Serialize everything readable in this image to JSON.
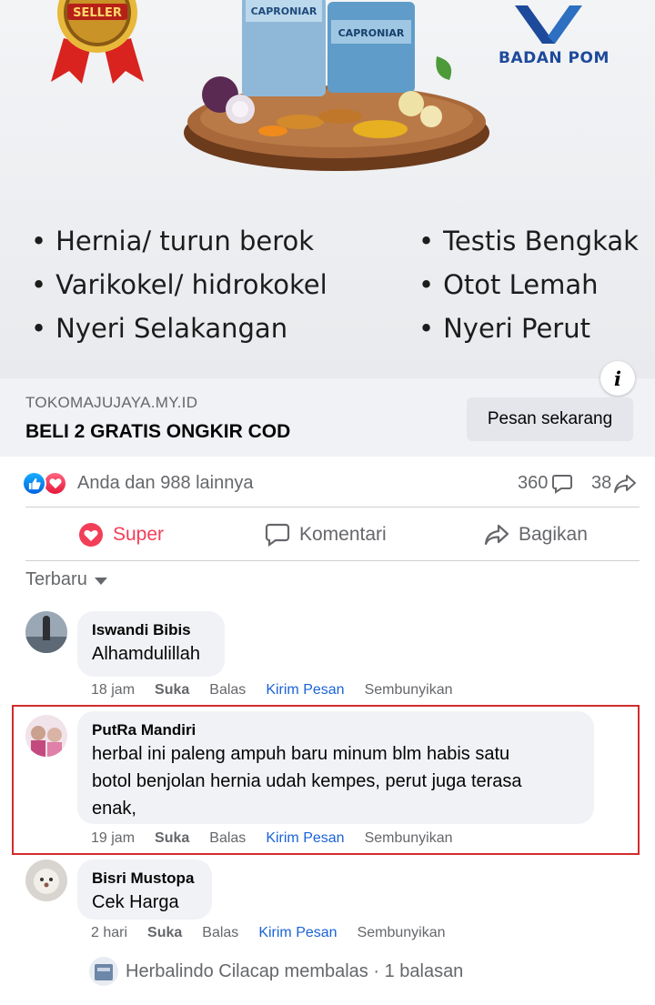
{
  "ad": {
    "seller_badge": "SELLER",
    "badan_pom": "BADAN POM",
    "product_label": "CAPRONIAR prima",
    "bullets_left": [
      "Hernia/ turun berok",
      "Varikokel/ hidrokokel",
      "Nyeri Selakangan"
    ],
    "bullets_right": [
      "Testis Bengkak",
      "Otot Lemah",
      "Nyeri Perut"
    ],
    "domain": "TOKOMAJUJAYA.MY.ID",
    "headline": "BELI 2 GRATIS ONGKIR COD",
    "cta_label": "Pesan sekarang",
    "info_icon": "i"
  },
  "reactions": {
    "summary": "Anda dan 988 lainnya",
    "comment_count": "360",
    "share_count": "38"
  },
  "actions": {
    "super_label": "Super",
    "comment_label": "Komentari",
    "share_label": "Bagikan"
  },
  "sort": {
    "label": "Terbaru"
  },
  "comments": [
    {
      "author": "Iswandi Bibis",
      "text": "Alhamdulillah",
      "time": "18 jam",
      "like": "Suka",
      "reply": "Balas",
      "message": "Kirim Pesan",
      "hide": "Sembunyikan"
    },
    {
      "author": "PutRa Mandiri",
      "text_lines": [
        "herbal ini paleng ampuh baru minum blm habis satu",
        "botol benjolan hernia udah kempes, perut juga terasa",
        "enak,"
      ],
      "time": "19 jam",
      "like": "Suka",
      "reply": "Balas",
      "message": "Kirim Pesan",
      "hide": "Sembunyikan"
    },
    {
      "author": "Bisri Mustopa",
      "text": "Cek Harga",
      "time": "2 hari",
      "like": "Suka",
      "reply": "Balas",
      "message": "Kirim Pesan",
      "hide": "Sembunyikan"
    }
  ],
  "reply_summary": "Herbalindo Cilacap membalas · 1 balasan",
  "colors": {
    "super_red": "#f33e58",
    "link_blue": "#1a63d6",
    "highlight_red": "#d22b2b",
    "badan_pom_blue": "#1e4a9b"
  }
}
